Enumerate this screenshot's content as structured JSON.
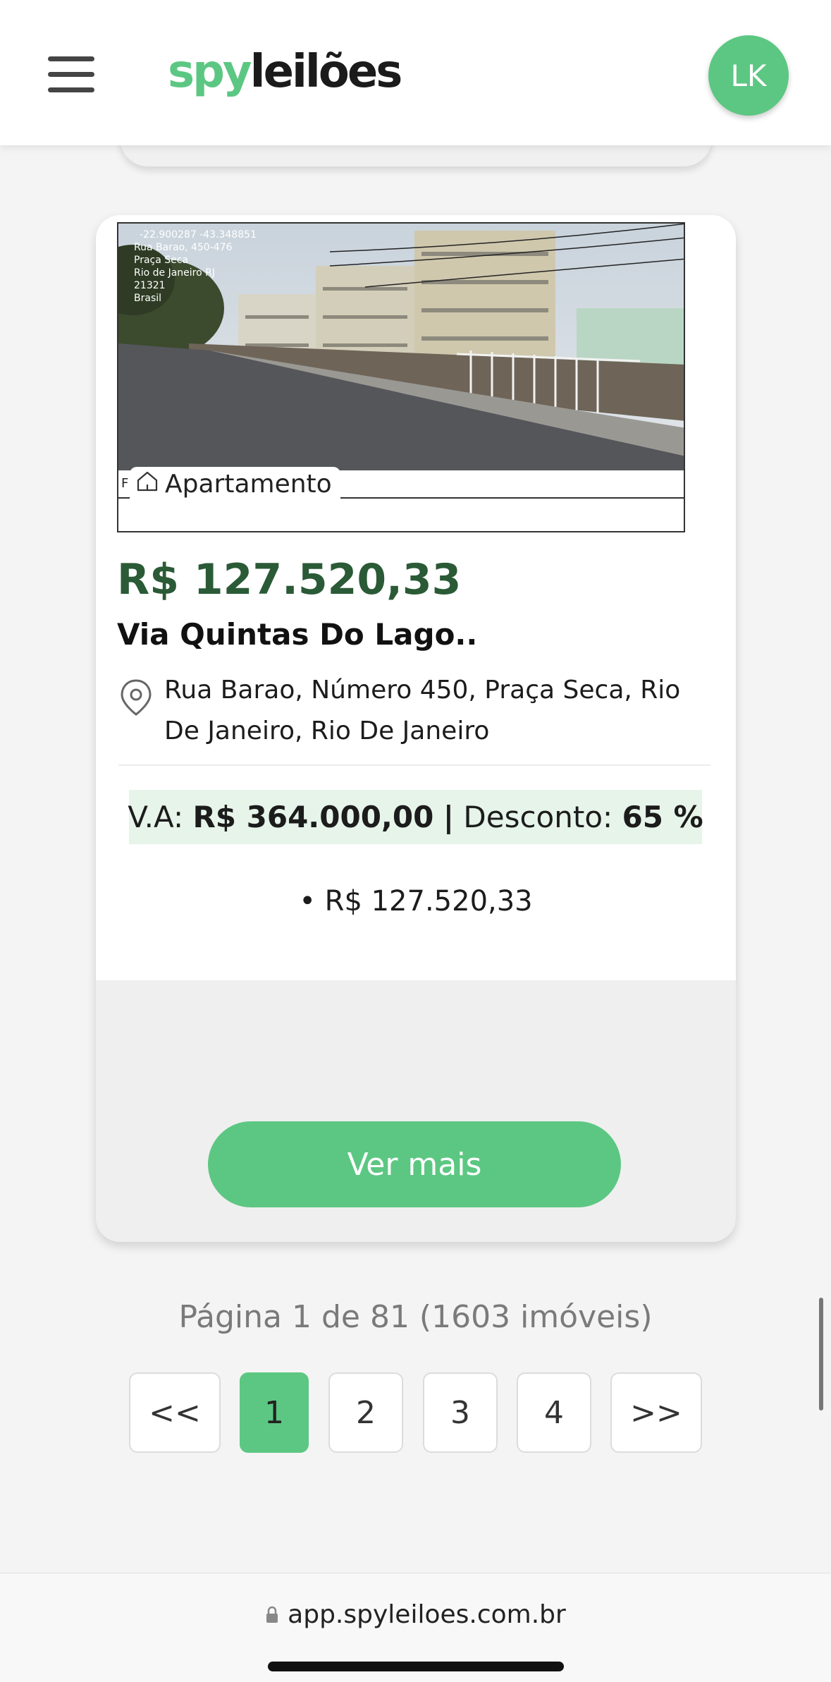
{
  "header": {
    "logo_part1": "spy",
    "logo_part2": "leilões",
    "avatar_initials": "LK"
  },
  "listing": {
    "type_label": "Apartamento",
    "price": "R$ 127.520,33",
    "title": "Via Quintas Do Lago..",
    "address": "Rua Barao, Número 450, Praça Seca, Rio De Janeiro, Rio De Janeiro",
    "va_label": "V.A:",
    "va_value": "R$ 364.000,00",
    "separator": "|",
    "discount_label": "Desconto:",
    "discount_value": "65 %",
    "bullet_price": "• R$ 127.520,33",
    "cta_label": "Ver mais",
    "photo_overlay_letter": "F",
    "photo_overlay_text": [
      "-22.900287 -43.348851",
      "Rua Barao, 450-476",
      "Praça Seca",
      "Rio de Janeiro RJ",
      "21321",
      "Brasil"
    ]
  },
  "pagination": {
    "info": "Página 1 de 81 (1603 imóveis)",
    "first_label": "<<",
    "pages": [
      "1",
      "2",
      "3",
      "4"
    ],
    "active_page": "1",
    "last_label": ">>"
  },
  "browser": {
    "url": "app.spyleiloes.com.br"
  },
  "colors": {
    "brand_green": "#5cc782",
    "price_green": "#2a5a36",
    "va_bg": "#e6f4ea"
  }
}
